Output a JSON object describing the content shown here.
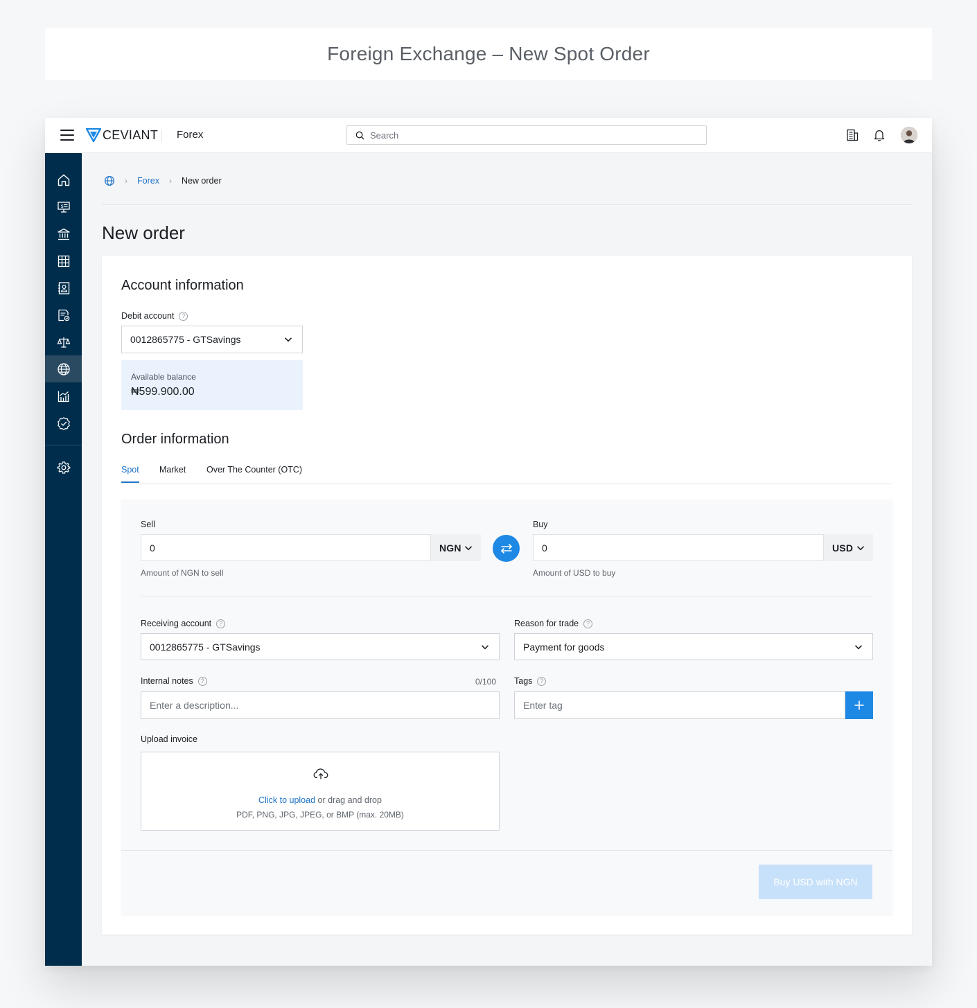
{
  "caption": "Foreign Exchange – New Spot Order",
  "topbar": {
    "logo_text": "CEVIANT",
    "module": "Forex",
    "search_placeholder": "Search",
    "icons": [
      "menu-icon",
      "building-icon",
      "bell-icon",
      "avatar"
    ]
  },
  "sidebar": {
    "items": [
      {
        "icon": "home-icon"
      },
      {
        "icon": "payments-icon"
      },
      {
        "icon": "bank-icon"
      },
      {
        "icon": "grid-icon"
      },
      {
        "icon": "contacts-icon"
      },
      {
        "icon": "invoice-icon"
      },
      {
        "icon": "scale-icon"
      },
      {
        "icon": "globe-icon",
        "active": true
      },
      {
        "icon": "chart-icon"
      },
      {
        "icon": "badge-check-icon"
      },
      {
        "icon": "settings-icon"
      }
    ]
  },
  "breadcrumb": {
    "items": [
      "Forex",
      "New order"
    ]
  },
  "page_title": "New order",
  "account_info": {
    "title": "Account information",
    "debit_label": "Debit account",
    "debit_value": "0012865775 - GTSavings",
    "balance_label": "Available balance",
    "balance_value": "₦599.900.00"
  },
  "order_info": {
    "title": "Order information",
    "tabs": [
      {
        "label": "Spot",
        "active": true
      },
      {
        "label": "Market"
      },
      {
        "label": "Over The Counter (OTC)"
      }
    ]
  },
  "spot": {
    "sell_label": "Sell",
    "sell_value": "0",
    "sell_currency": "NGN",
    "sell_hint": "Amount of NGN to sell",
    "buy_label": "Buy",
    "buy_value": "0",
    "buy_currency": "USD",
    "buy_hint": "Amount of USD to buy",
    "receiving_label": "Receiving account",
    "receiving_value": "0012865775 - GTSavings",
    "reason_label": "Reason for trade",
    "reason_value": "Payment for goods",
    "notes_label": "Internal notes",
    "notes_counter": "0/100",
    "notes_placeholder": "Enter a description...",
    "tags_label": "Tags",
    "tags_placeholder": "Enter tag",
    "upload_label": "Upload invoice",
    "upload_link": "Click to upload",
    "upload_rest": " or drag and drop",
    "upload_formats": "PDF, PNG, JPG, JPEG, or BMP (max. 20MB)",
    "submit_label": "Buy USD with NGN"
  },
  "colors": {
    "sidebar": "#002d4b",
    "accent": "#1e88e5",
    "link": "#1f73c7",
    "balance_bg": "#eaf3fd",
    "disabled_button": "#c8e1fa"
  }
}
